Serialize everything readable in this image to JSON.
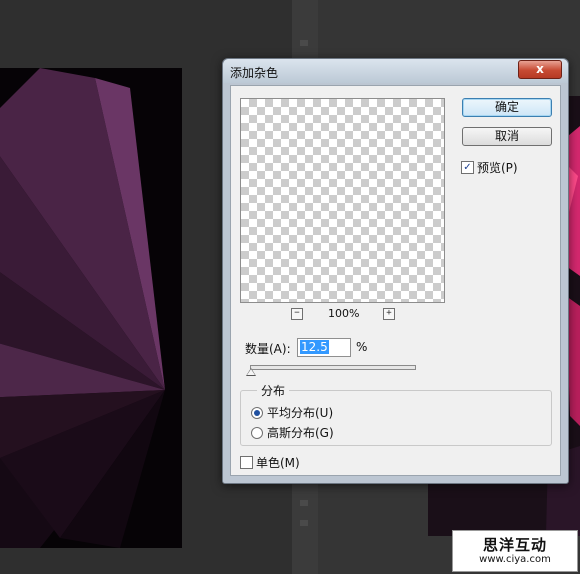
{
  "dialog": {
    "title": "添加杂色",
    "close_label": "x",
    "ok_label": "确定",
    "cancel_label": "取消",
    "preview_checkbox": {
      "label": "预览(P)",
      "checked": true
    },
    "zoom": {
      "minus": "−",
      "plus": "+",
      "value": "100%"
    },
    "amount": {
      "label": "数量(A):",
      "value": "12.5",
      "unit": "%"
    },
    "distribution": {
      "label": "分布",
      "options": [
        {
          "label": "平均分布(U)",
          "selected": true
        },
        {
          "label": "高斯分布(G)",
          "selected": false
        }
      ]
    },
    "monochrome": {
      "label": "单色(M)",
      "checked": false
    }
  },
  "watermark": {
    "title": "思洋互动",
    "url": "www.ciya.com"
  },
  "colors": {
    "canvas_purple": "#5a2a55",
    "canvas_pink": "#d4286e"
  }
}
